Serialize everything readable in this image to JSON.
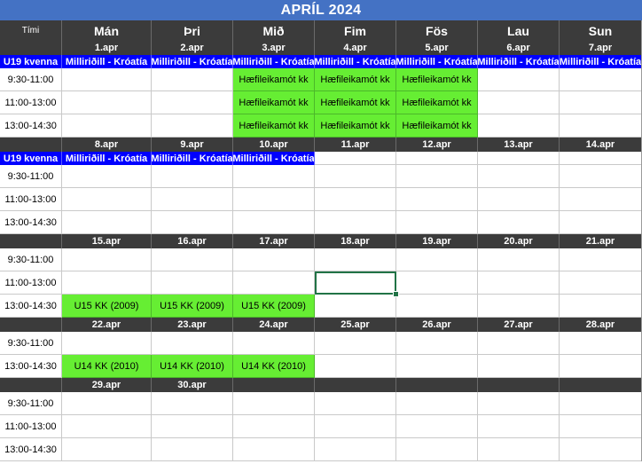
{
  "title": "APRÍL 2024",
  "header": {
    "time_label": "Tími",
    "days": [
      "Mán",
      "Þri",
      "Mið",
      "Fim",
      "Fös",
      "Lau",
      "Sun"
    ]
  },
  "weeks": [
    {
      "dates": [
        "1.apr",
        "2.apr",
        "3.apr",
        "4.apr",
        "5.apr",
        "6.apr",
        "7.apr"
      ],
      "banner": {
        "label": "U19 kvenna",
        "cells": [
          "Milliriðill - Króatía",
          "Milliriðill - Króatía",
          "Milliriðill - Króatía",
          "Milliriðill - Króatía",
          "Milliriðill - Króatía",
          "Milliriðill - Króatía",
          "Milliriðill - Króatía"
        ]
      },
      "rows": [
        {
          "time": "9:30-11:00",
          "cells": [
            "",
            "",
            "Hæfileikamót kk",
            "Hæfileikamót kk",
            "Hæfileikamót kk",
            "",
            ""
          ]
        },
        {
          "time": "11:00-13:00",
          "cells": [
            "",
            "",
            "Hæfileikamót kk",
            "Hæfileikamót kk",
            "Hæfileikamót kk",
            "",
            ""
          ]
        },
        {
          "time": "13:00-14:30",
          "cells": [
            "",
            "",
            "Hæfileikamót kk",
            "Hæfileikamót kk",
            "Hæfileikamót kk",
            "",
            ""
          ]
        }
      ]
    },
    {
      "dates": [
        "8.apr",
        "9.apr",
        "10.apr",
        "11.apr",
        "12.apr",
        "13.apr",
        "14.apr"
      ],
      "banner": {
        "label": "U19 kvenna",
        "cells": [
          "Milliriðill - Króatía",
          "Milliriðill - Króatía",
          "Milliriðill - Króatía",
          "",
          "",
          "",
          ""
        ]
      },
      "rows": [
        {
          "time": "9:30-11:00",
          "cells": [
            "",
            "",
            "",
            "",
            "",
            "",
            ""
          ]
        },
        {
          "time": "11:00-13:00",
          "cells": [
            "",
            "",
            "",
            "",
            "",
            "",
            ""
          ]
        },
        {
          "time": "13:00-14:30",
          "cells": [
            "",
            "",
            "",
            "",
            "",
            "",
            ""
          ]
        }
      ]
    },
    {
      "dates": [
        "15.apr",
        "16.apr",
        "17.apr",
        "18.apr",
        "19.apr",
        "20.apr",
        "21.apr"
      ],
      "rows": [
        {
          "time": "9:30-11:00",
          "cells": [
            "",
            "",
            "",
            "",
            "",
            "",
            ""
          ]
        },
        {
          "time": "11:00-13:00",
          "cells": [
            "",
            "",
            "",
            "",
            "",
            "",
            ""
          ]
        },
        {
          "time": "13:00-14:30",
          "cells": [
            "U15 KK (2009)",
            "U15 KK (2009)",
            "U15 KK (2009)",
            "",
            "",
            "",
            ""
          ]
        }
      ]
    },
    {
      "dates": [
        "22.apr",
        "23.apr",
        "24.apr",
        "25.apr",
        "26.apr",
        "27.apr",
        "28.apr"
      ],
      "rows": [
        {
          "time": "9:30-11:00",
          "cells": [
            "",
            "",
            "",
            "",
            "",
            "",
            ""
          ]
        },
        {
          "time": "13:00-14:30",
          "cells": [
            "U14 KK (2010)",
            "U14 KK (2010)",
            "U14 KK (2010)",
            "",
            "",
            "",
            ""
          ]
        }
      ]
    },
    {
      "dates": [
        "29.apr",
        "30.apr",
        "",
        "",
        "",
        "",
        ""
      ],
      "rows": [
        {
          "time": "9:30-11:00",
          "cells": [
            "",
            "",
            "",
            "",
            "",
            "",
            ""
          ]
        },
        {
          "time": "11:00-13:00",
          "cells": [
            "",
            "",
            "",
            "",
            "",
            "",
            ""
          ]
        },
        {
          "time": "13:00-14:30",
          "cells": [
            "",
            "",
            "",
            "",
            "",
            "",
            ""
          ]
        }
      ]
    }
  ],
  "selected_cell": {
    "week": 2,
    "row": 1,
    "day": 3
  },
  "colors": {
    "title_bg": "#4472c4",
    "header_bg": "#3b3b3b",
    "banner_bg": "#0000ff",
    "event_bg": "#66ee33",
    "selection": "#217346"
  }
}
